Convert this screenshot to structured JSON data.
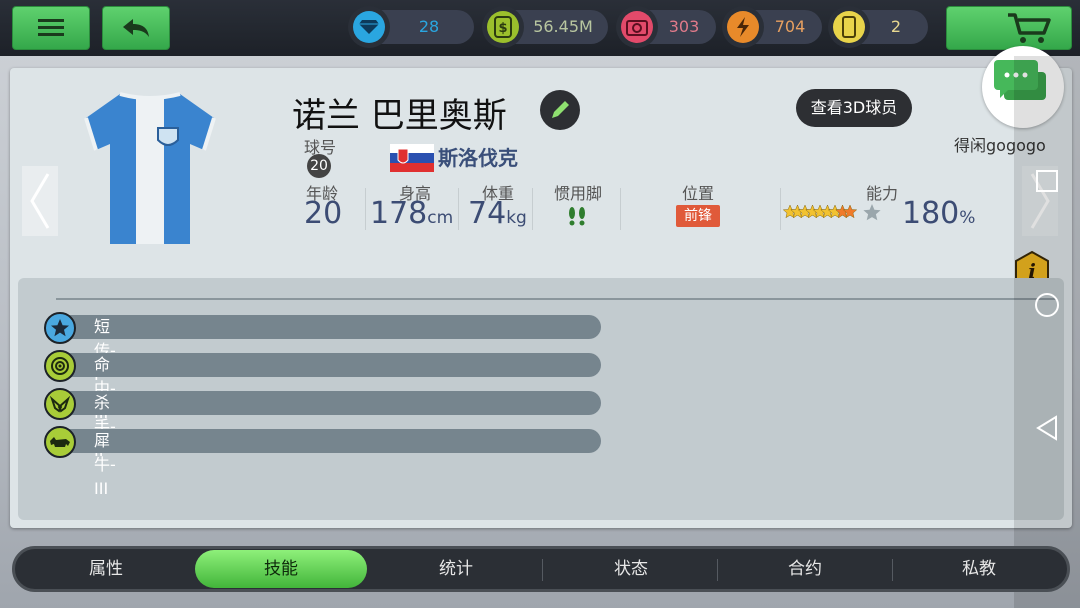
{
  "topbar": {
    "resources": [
      {
        "name": "diamonds",
        "icon": "diamond-icon",
        "value": "28",
        "color": "#2aa6e0",
        "text_color": "#2aa6e0"
      },
      {
        "name": "money",
        "icon": "cash-icon",
        "value": "56.45M",
        "color": "#9bbf2c",
        "text_color": "#b8c6a0"
      },
      {
        "name": "medical",
        "icon": "medkit-icon",
        "value": "303",
        "color": "#e24a6a",
        "text_color": "#e07a8a"
      },
      {
        "name": "energy",
        "icon": "lightning-icon",
        "value": "704",
        "color": "#e88a2a",
        "text_color": "#e8a060"
      },
      {
        "name": "cards",
        "icon": "card-icon",
        "value": "2",
        "color": "#e8d44a",
        "text_color": "#e8d890"
      }
    ]
  },
  "player": {
    "name": "诺兰 巴里奥斯",
    "number_label": "球号",
    "number": "20",
    "nationality": "斯洛伐克",
    "age_label": "年龄",
    "age": "20",
    "height_label": "身高",
    "height": "178",
    "height_unit": "cm",
    "weight_label": "体重",
    "weight": "74",
    "weight_unit": "kg",
    "foot_label": "惯用脚",
    "position_label": "位置",
    "position": "前锋",
    "ability_label": "能力",
    "ability": "180",
    "ability_unit": "%",
    "stars": 4.5,
    "view3d_label": "查看3D球员",
    "chat_user": "得闲gogogo"
  },
  "skills": [
    {
      "name": "短传-I",
      "icon": "star-icon",
      "color": "#4aa8e0"
    },
    {
      "name": "命中-III",
      "icon": "target-icon",
      "color": "#a8cc38"
    },
    {
      "name": "杀手-II",
      "icon": "pistols-icon",
      "color": "#a8cc38"
    },
    {
      "name": "犀牛-III",
      "icon": "rhino-icon",
      "color": "#a8cc38"
    }
  ],
  "tabs": [
    {
      "label": "属性",
      "active": false
    },
    {
      "label": "技能",
      "active": true
    },
    {
      "label": "统计",
      "active": false
    },
    {
      "label": "状态",
      "active": false
    },
    {
      "label": "合约",
      "active": false
    },
    {
      "label": "私教",
      "active": false
    }
  ]
}
